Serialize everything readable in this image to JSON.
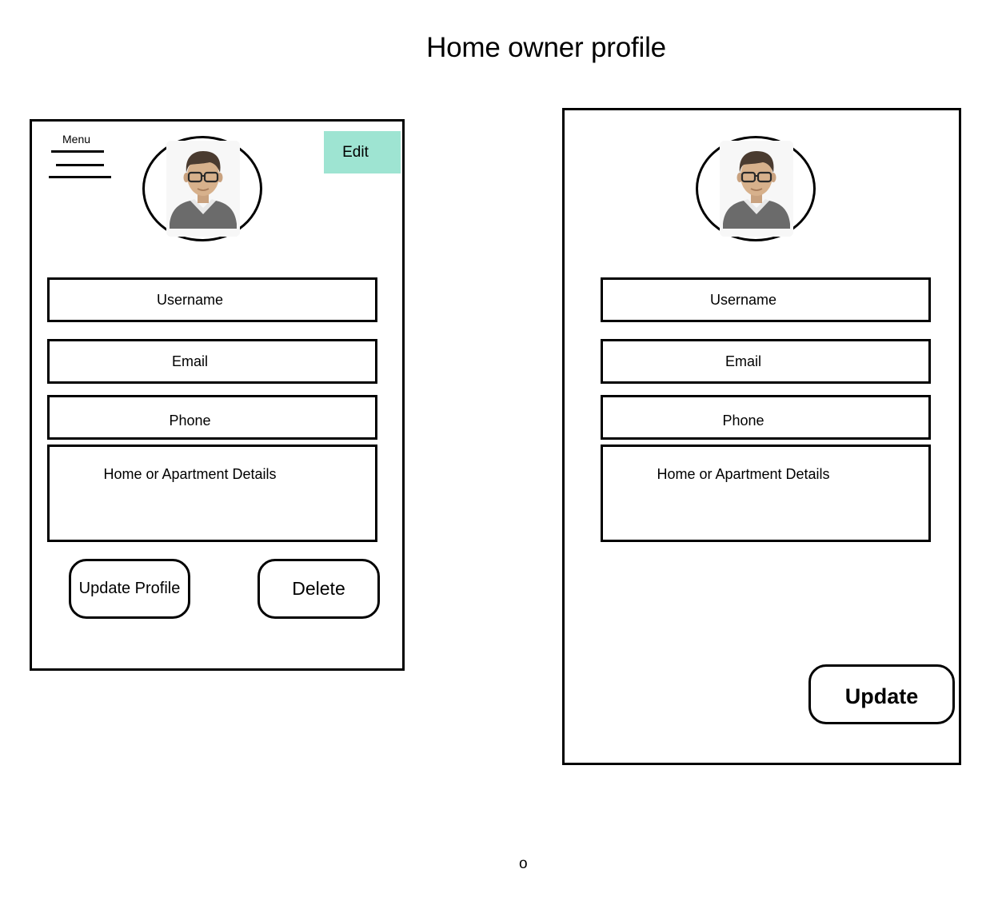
{
  "page": {
    "title": "Home owner profile",
    "footer_mark": "o"
  },
  "view_screen": {
    "menu_label": "Menu",
    "edit_label": "Edit",
    "edit_color": "#9ee4d2",
    "fields": {
      "username": "Username",
      "email": "Email",
      "phone": "Phone",
      "details": "Home or Apartment Details"
    },
    "update_profile_label": "Update Profile",
    "delete_label": "Delete"
  },
  "edit_screen": {
    "fields": {
      "username": "Username",
      "email": "Email",
      "phone": "Phone",
      "details": "Home or Apartment Details"
    },
    "update_label": "Update"
  },
  "icons": {
    "menu": "hamburger-icon",
    "avatar": "user-avatar-icon"
  }
}
